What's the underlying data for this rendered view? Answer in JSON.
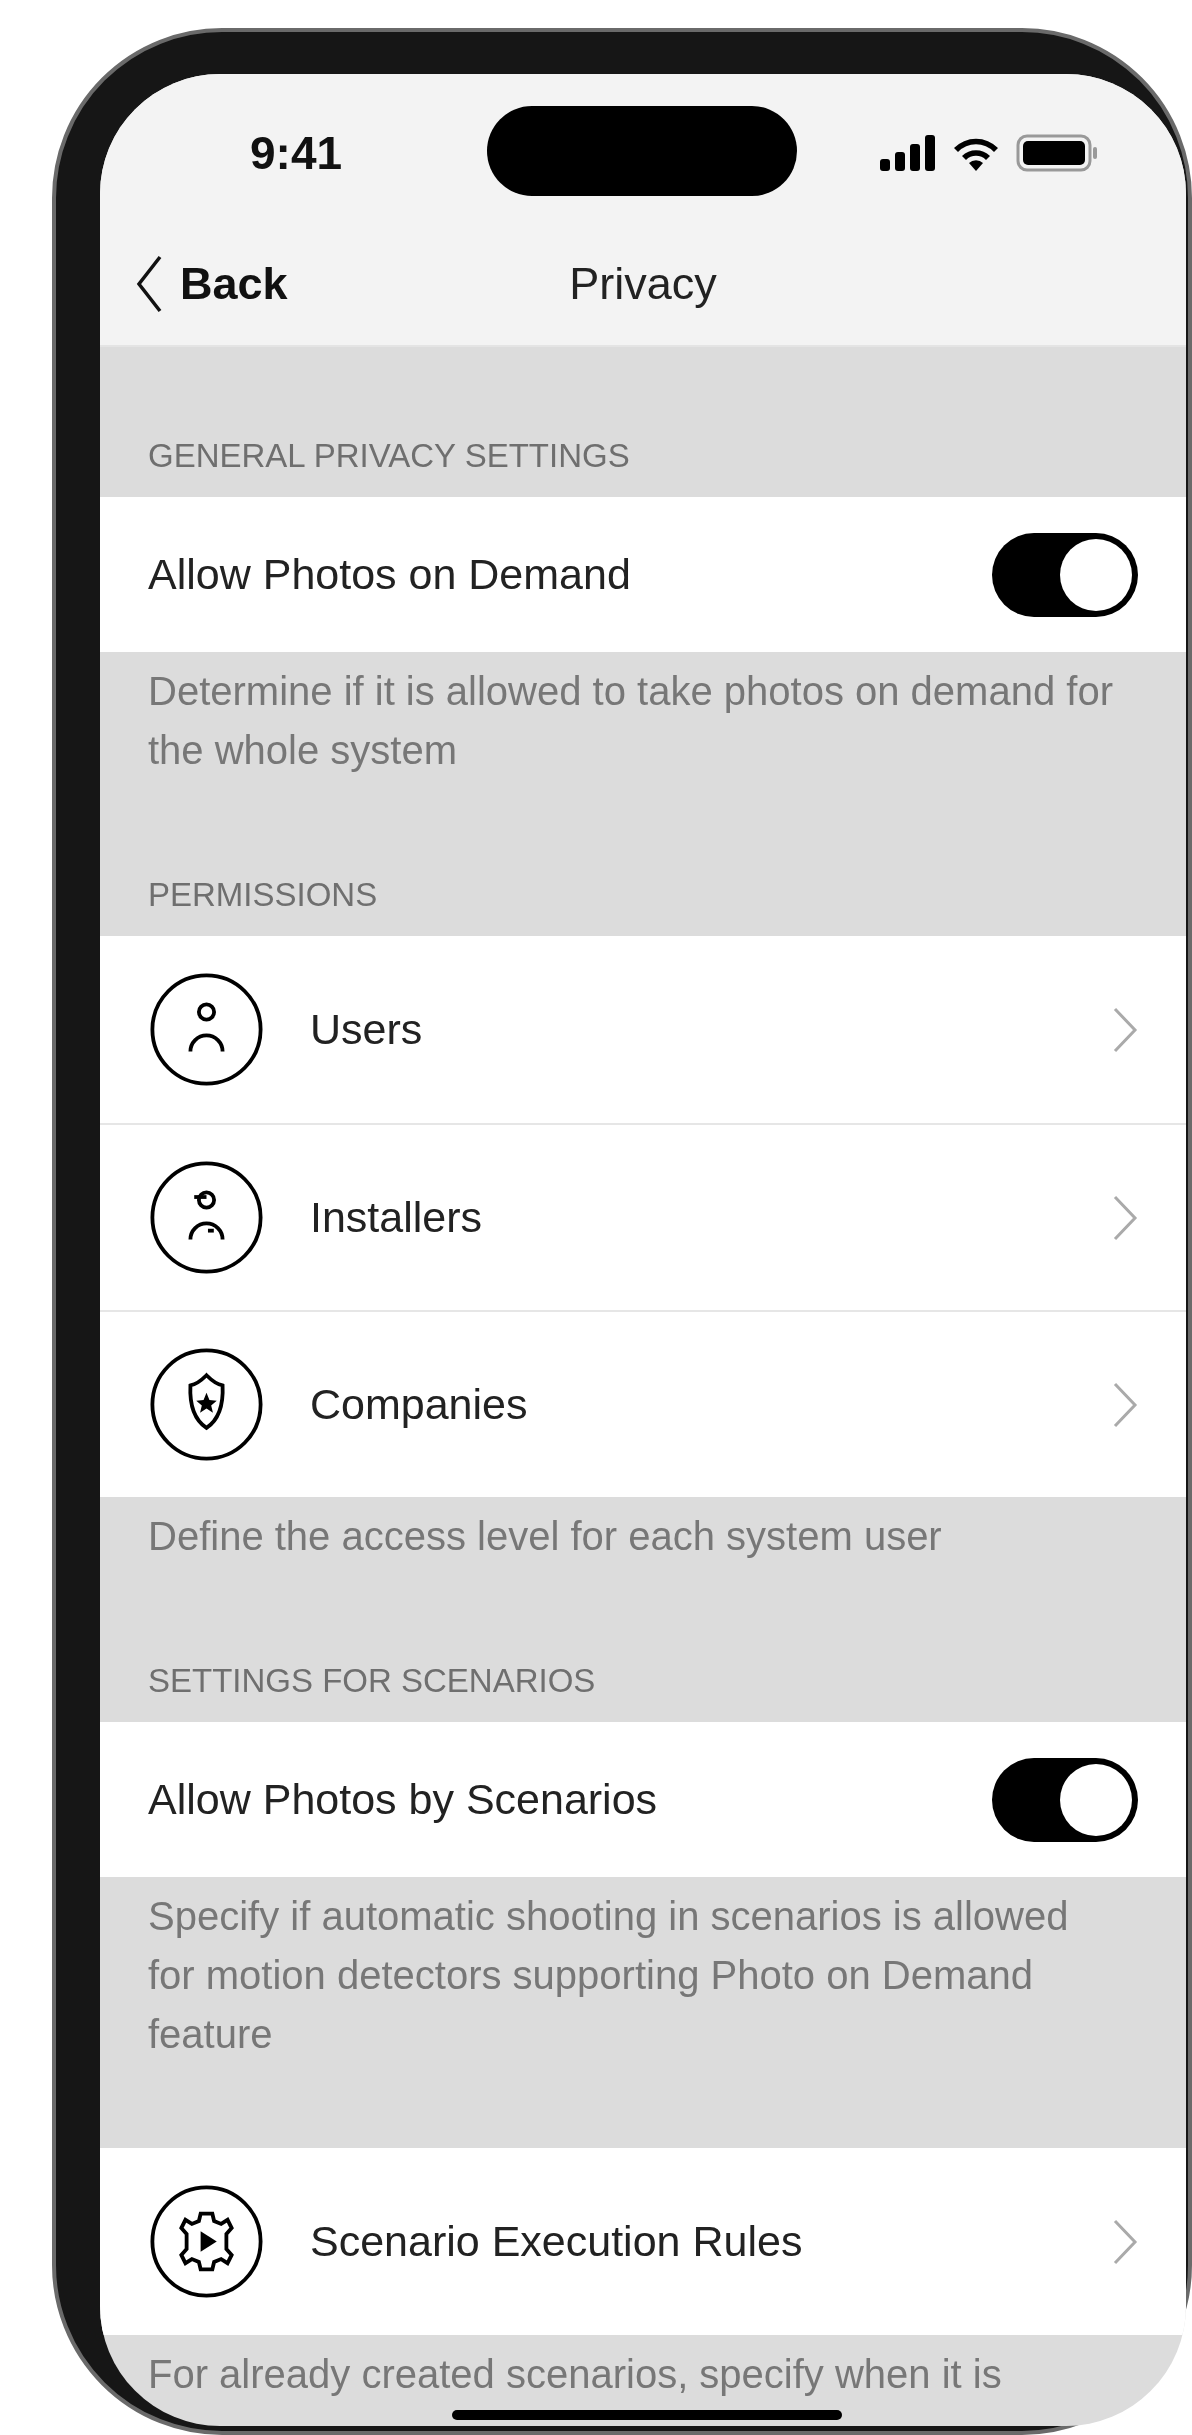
{
  "status_bar": {
    "time": "9:41"
  },
  "nav": {
    "back": "Back",
    "title": "Privacy"
  },
  "sections": [
    {
      "header": "GENERAL PRIVACY SETTINGS",
      "rows": [
        {
          "kind": "toggle",
          "label": "Allow Photos on Demand",
          "on": true
        }
      ],
      "footer": "Determine if it is allowed to take photos on demand for the whole system"
    },
    {
      "header": "PERMISSIONS",
      "rows": [
        {
          "kind": "link",
          "label": "Users"
        },
        {
          "kind": "link",
          "label": "Installers"
        },
        {
          "kind": "link",
          "label": "Companies"
        }
      ],
      "footer": "Define the access level for each system user"
    },
    {
      "header": "SETTINGS FOR SCENARIOS",
      "rows": [
        {
          "kind": "toggle",
          "label": "Allow Photos by Scenarios",
          "on": true
        }
      ],
      "footer": "Specify if automatic shooting in scenarios is allowed for motion detectors supporting Photo on Demand feature"
    },
    {
      "rows": [
        {
          "kind": "link",
          "label": "Scenario Execution Rules"
        }
      ],
      "footer": "For already created scenarios, specify when it is"
    }
  ]
}
